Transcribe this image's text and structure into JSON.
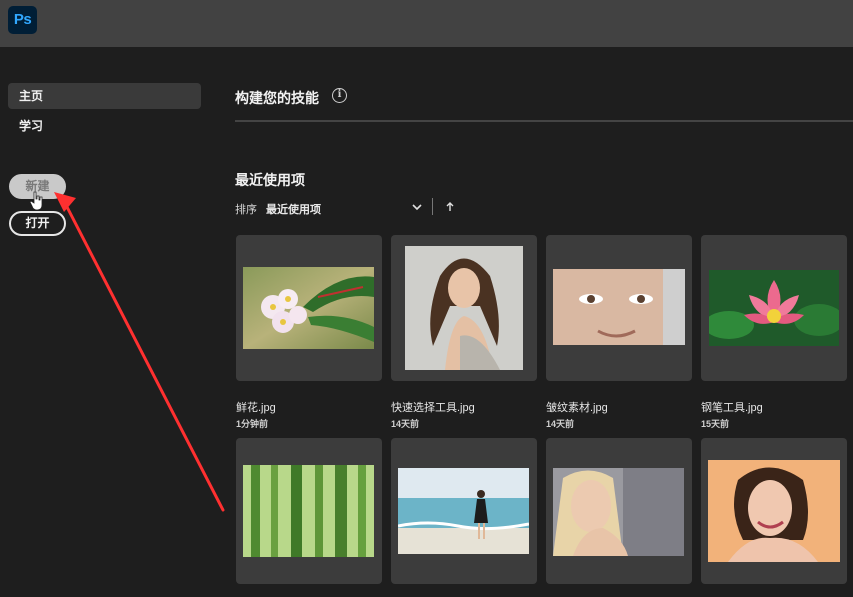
{
  "app": {
    "logo_text": "Ps"
  },
  "sidebar": {
    "items": [
      {
        "label": "主页",
        "active": true
      },
      {
        "label": "学习",
        "active": false
      }
    ],
    "new_button": "新建",
    "open_button": "打开"
  },
  "main": {
    "skills_title": "构建您的技能",
    "info_icon_glyph": "i",
    "recent_title": "最近使用项",
    "sort_label": "排序",
    "sort_value": "最近使用项",
    "files": [
      {
        "name": "鲜花.jpg",
        "time": "1分钟前"
      },
      {
        "name": "快速选择工具.jpg",
        "time": "14天前"
      },
      {
        "name": "皱纹素材.jpg",
        "time": "14天前"
      },
      {
        "name": "钢笔工具.jpg",
        "time": "15天前"
      }
    ]
  },
  "colors": {
    "background": "#1e1e1e",
    "topbar": "#424242",
    "card": "#3c3c3c",
    "annotation_arrow": "#ff3030",
    "ps_blue": "#31a8ff"
  }
}
